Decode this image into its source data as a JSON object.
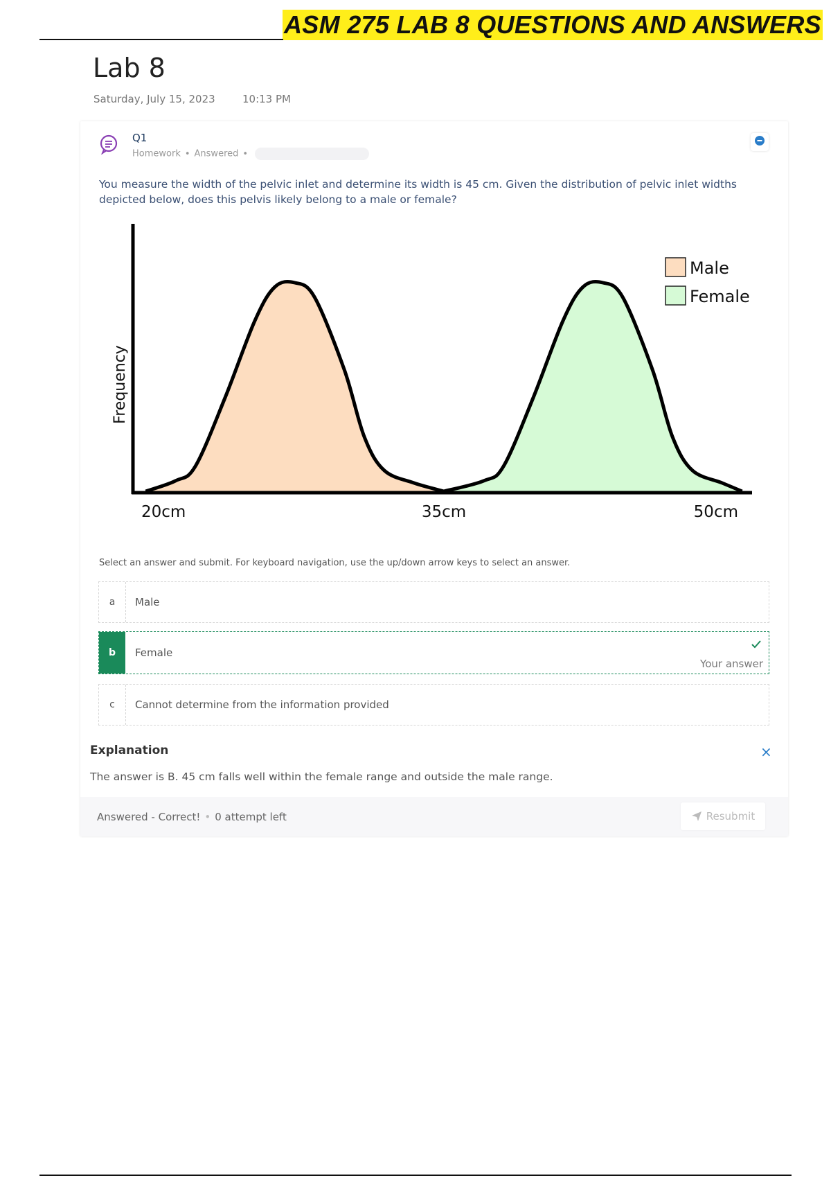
{
  "banner": "ASM 275 LAB 8 QUESTIONS AND ANSWERS",
  "page": {
    "title": "Lab 8",
    "date": "Saturday, July 15, 2023",
    "time": "10:13 PM"
  },
  "question": {
    "number": "Q1",
    "meta_type": "Homework",
    "meta_status": "Answered",
    "meta_sep": "•",
    "prompt": "You measure the width of the pelvic inlet and determine its width is 45 cm. Given the distribution of pelvic inlet widths depicted below, does this pelvis likely belong to a male or female?",
    "instructions": "Select an answer and submit. For keyboard navigation, use the up/down arrow keys to select an answer.",
    "options": [
      {
        "letter": "a",
        "label": "Male"
      },
      {
        "letter": "b",
        "label": "Female",
        "selected": true,
        "tag": "Your answer"
      },
      {
        "letter": "c",
        "label": "Cannot determine from the information provided"
      }
    ],
    "explanation_title": "Explanation",
    "explanation_close": "×",
    "explanation": "The answer is B. 45 cm falls well within the female range and outside the male range.",
    "status_result": "Answered - Correct!",
    "status_sep": "•",
    "status_attempts": "0 attempt left",
    "resubmit_label": "Resubmit"
  },
  "chart_data": {
    "type": "area",
    "title": "",
    "xlabel": "",
    "ylabel": "Frequency",
    "x_ticks": [
      "20cm",
      "35cm",
      "50cm"
    ],
    "x_tick_values": [
      20,
      35,
      50
    ],
    "xlim": [
      19.5,
      50.5
    ],
    "y_axis_ticks": false,
    "legend_position": "top-right",
    "series": [
      {
        "name": "Male",
        "color": "#fdddc0",
        "x": [
          20,
          21.5,
          22.5,
          24,
          25.5,
          26.5,
          27.5,
          28.5,
          30,
          31,
          32,
          33.5,
          35
        ],
        "y": [
          0,
          0.05,
          0.12,
          0.45,
          0.82,
          0.98,
          1.0,
          0.93,
          0.58,
          0.26,
          0.1,
          0.04,
          0
        ]
      },
      {
        "name": "Female",
        "color": "#d6fad6",
        "x": [
          35,
          37,
          38,
          39.5,
          41,
          42,
          43,
          44,
          45.5,
          46.5,
          47.5,
          49,
          50
        ],
        "y": [
          0,
          0.05,
          0.12,
          0.45,
          0.82,
          0.98,
          1.0,
          0.93,
          0.58,
          0.26,
          0.1,
          0.04,
          0
        ]
      }
    ]
  }
}
